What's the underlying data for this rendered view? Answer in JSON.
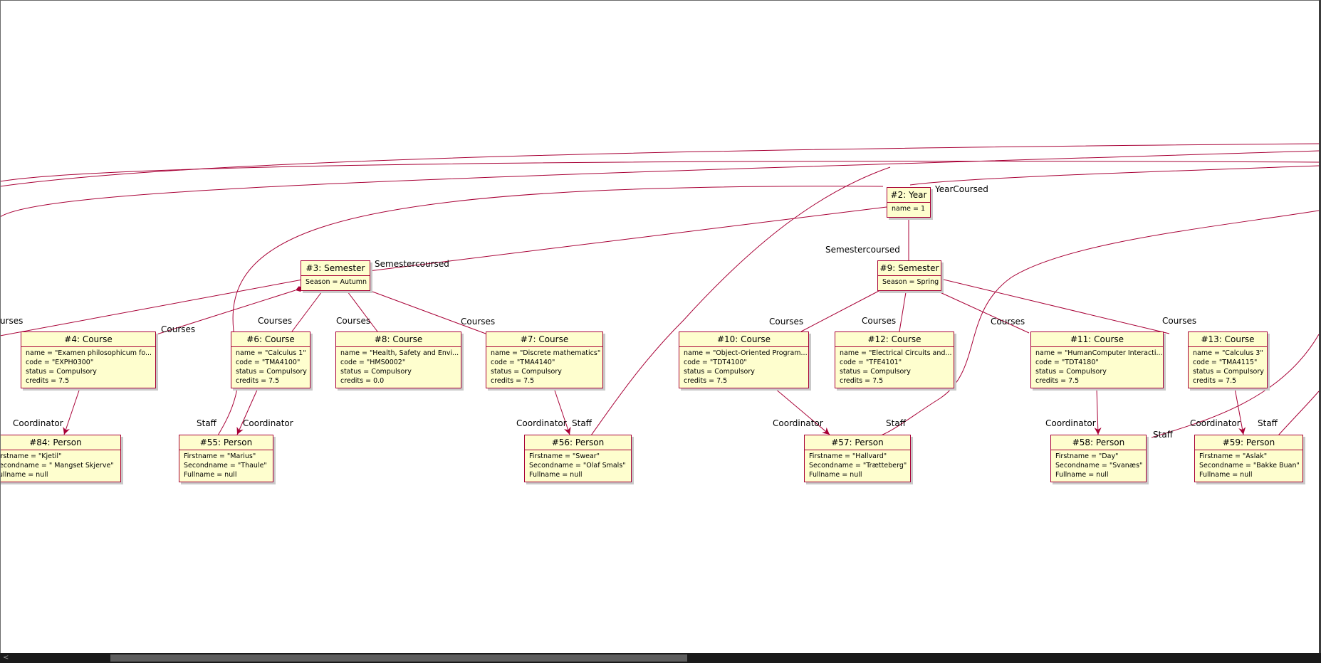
{
  "edge_labels": {
    "year_coursed": "YearCoursed",
    "semestercoursed_left": "Semestercoursed",
    "semestercoursed_right": "Semestercoursed",
    "courses_far_left": "urses",
    "courses": "Courses",
    "coordinator": "Coordinator",
    "staff": "Staff"
  },
  "objects": {
    "year2": {
      "title": "#2: Year",
      "attrs": [
        "name = 1"
      ]
    },
    "semester3": {
      "title": "#3: Semester",
      "attrs": [
        "Season = Autumn"
      ]
    },
    "semester9": {
      "title": "#9: Semester",
      "attrs": [
        "Season = Spring"
      ]
    },
    "course4": {
      "title": "#4: Course",
      "attrs": [
        "name = \"Examen philosophicum fo...",
        "code = \"EXPH0300\"",
        "status = Compulsory",
        "credits = 7.5"
      ]
    },
    "course6": {
      "title": "#6: Course",
      "attrs": [
        "name = \"Calculus 1\"",
        "code = \"TMA4100\"",
        "status = Compulsory",
        "credits = 7.5"
      ]
    },
    "course8": {
      "title": "#8: Course",
      "attrs": [
        "name = \"Health, Safety and Envi...",
        "code = \"HMS0002\"",
        "status = Compulsory",
        "credits = 0.0"
      ]
    },
    "course7": {
      "title": "#7: Course",
      "attrs": [
        "name = \"Discrete mathematics\"",
        "code = \"TMA4140\"",
        "status = Compulsory",
        "credits = 7.5"
      ]
    },
    "course10": {
      "title": "#10: Course",
      "attrs": [
        "name = \"Object-Oriented Program...",
        "code = \"TDT4100\"",
        "status = Compulsory",
        "credits = 7.5"
      ]
    },
    "course12": {
      "title": "#12: Course",
      "attrs": [
        "name = \"Electrical Circuits and...",
        "code = \"TFE4101\"",
        "status = Compulsory",
        "credits = 7.5"
      ]
    },
    "course11": {
      "title": "#11: Course",
      "attrs": [
        "name = \"HumanComputer Interacti...",
        "code = \"TDT4180\"",
        "status = Compulsory",
        "credits = 7.5"
      ]
    },
    "course13": {
      "title": "#13: Course",
      "attrs": [
        "name = \"Calculus 3\"",
        "code = \"TMA4115\"",
        "status = Compulsory",
        "credits = 7.5"
      ]
    },
    "person84": {
      "title": "#84: Person",
      "attrs": [
        "Firstname = \"Kjetil\"",
        "Secondname = \" Mangset Skjerve\"",
        "Fullname = null"
      ]
    },
    "person55": {
      "title": "#55: Person",
      "attrs": [
        "Firstname = \"Marius\"",
        "Secondname = \"Thaule\"",
        "Fullname = null"
      ]
    },
    "person56": {
      "title": "#56: Person",
      "attrs": [
        "Firstname = \"Swear\"",
        "Secondname = \"Olaf Smals\"",
        "Fullname = null"
      ]
    },
    "person57": {
      "title": "#57: Person",
      "attrs": [
        "Firstname = \"Hallvard\"",
        "Secondname = \"Trætteberg\"",
        "Fullname = null"
      ]
    },
    "person58": {
      "title": "#58: Person",
      "attrs": [
        "Firstname = \"Day\"",
        "Secondname = \"Svanæs\"",
        "Fullname = null"
      ]
    },
    "person59": {
      "title": "#59: Person",
      "attrs": [
        "Firstname = \"Aslak\"",
        "Secondname = \"Bakke Buan\"",
        "Fullname = null"
      ]
    }
  },
  "scrollbar": {
    "left_arrow": "<"
  },
  "colors": {
    "edge": "#a80036",
    "box_fill": "#fefece",
    "box_border": "#a80036"
  }
}
